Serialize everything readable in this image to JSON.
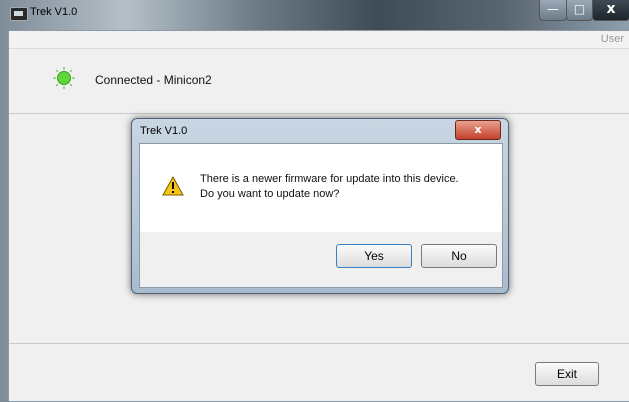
{
  "window": {
    "title": "Trek V1.0",
    "min_label": "—",
    "max_label": "□",
    "close_label": "x"
  },
  "menubar": {
    "user": "User"
  },
  "status": {
    "text": "Connected - Minicon2",
    "led_color": "#5fd63a"
  },
  "footer": {
    "exit_label": "Exit"
  },
  "dialog": {
    "title": "Trek V1.0",
    "close_label": "x",
    "message_line1": "There is a newer firmware for update into this device.",
    "message_line2": "Do you want to update now?",
    "yes_label": "Yes",
    "no_label": "No",
    "icon": "warning-icon"
  }
}
